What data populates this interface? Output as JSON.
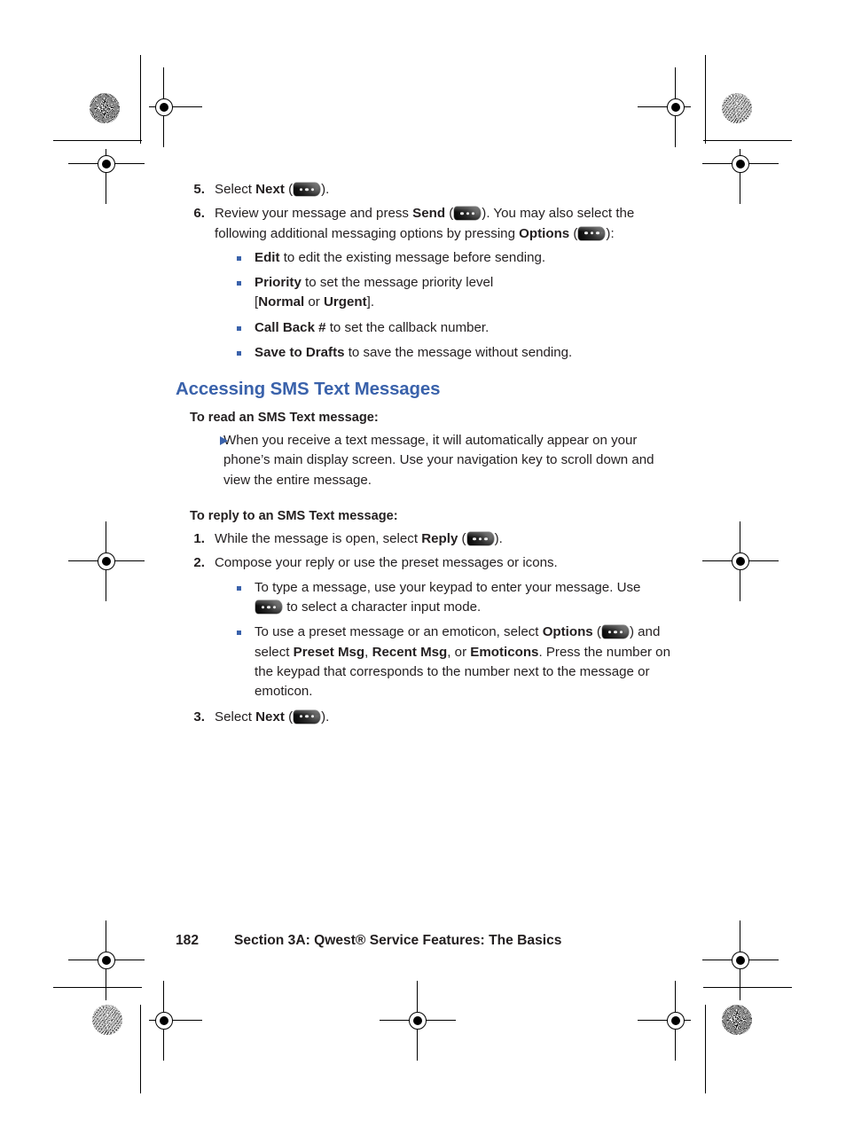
{
  "theme": {
    "accent_blue": "#3a62ab",
    "text_color": "#231f20",
    "bullet_color": "#3a62ab"
  },
  "icons": {
    "softkey": "softkey-three-dots-icon",
    "registration": "registration-crosshair-icon",
    "rosette": "print-rosette-icon",
    "square_bullet": "square-bullet-icon",
    "arrow_bullet": "triangle-bullet-icon"
  },
  "steps_top": [
    {
      "num": "5.",
      "segments": [
        {
          "t": "Select "
        },
        {
          "t": "Next",
          "b": true
        },
        {
          "t": " ("
        },
        {
          "t": "",
          "icon": "softkey"
        },
        {
          "t": ")."
        }
      ]
    },
    {
      "num": "6.",
      "segments": [
        {
          "t": "Review your message and press "
        },
        {
          "t": "Send",
          "b": true
        },
        {
          "t": " ("
        },
        {
          "t": "",
          "icon": "softkey"
        },
        {
          "t": "). You may also select the following additional messaging options by pressing "
        },
        {
          "t": "Options",
          "b": true
        },
        {
          "t": " ("
        },
        {
          "t": "",
          "icon": "softkey"
        },
        {
          "t": "):"
        }
      ]
    }
  ],
  "option_bullets": [
    {
      "segments": [
        {
          "t": "Edit",
          "b": true
        },
        {
          "t": " to edit the existing message before sending."
        }
      ]
    },
    {
      "segments": [
        {
          "t": "Priority",
          "b": true
        },
        {
          "t": " to set the message priority level"
        },
        {
          "br": true
        },
        {
          "t": "["
        },
        {
          "t": "Normal",
          "b": true
        },
        {
          "t": " or "
        },
        {
          "t": "Urgent",
          "b": true
        },
        {
          "t": "]."
        }
      ]
    },
    {
      "segments": [
        {
          "t": "Call Back #",
          "b": true
        },
        {
          "t": " to set the callback number."
        }
      ]
    },
    {
      "segments": [
        {
          "t": "Save to Drafts",
          "b": true
        },
        {
          "t": " to save the message without sending."
        }
      ]
    }
  ],
  "section": {
    "heading": "Accessing SMS Text Messages",
    "read_lead_in": "To read an SMS Text message:",
    "read_arrow_item": "When you receive a text message, it will automatically appear on your phone’s main display screen. Use your navigation key to scroll down and view the entire message.",
    "reply_lead_in": "To reply to an SMS Text message:"
  },
  "steps_reply": [
    {
      "num": "1.",
      "segments": [
        {
          "t": "While the message is open, select "
        },
        {
          "t": "Reply",
          "b": true
        },
        {
          "t": " ("
        },
        {
          "t": "",
          "icon": "softkey"
        },
        {
          "t": ")."
        }
      ]
    },
    {
      "num": "2.",
      "segments": [
        {
          "t": "Compose your reply or use the preset messages or icons."
        }
      ]
    },
    {
      "num": "3.",
      "segments": [
        {
          "t": "Select "
        },
        {
          "t": "Next",
          "b": true
        },
        {
          "t": " ("
        },
        {
          "t": "",
          "icon": "softkey"
        },
        {
          "t": ")."
        }
      ]
    }
  ],
  "reply_bullets": [
    {
      "segments": [
        {
          "t": "To type a message, use your keypad to enter your message. Use "
        },
        {
          "t": "",
          "icon": "softkey"
        },
        {
          "t": " to select a character input mode."
        }
      ]
    },
    {
      "segments": [
        {
          "t": "To use a preset message or an emoticon, select "
        },
        {
          "t": "Options",
          "b": true
        },
        {
          "t": " ("
        },
        {
          "t": "",
          "icon": "softkey"
        },
        {
          "t": ") and select "
        },
        {
          "t": "Preset Msg",
          "b": true
        },
        {
          "t": ", "
        },
        {
          "t": "Recent Msg",
          "b": true
        },
        {
          "t": ", or "
        },
        {
          "t": "Emoticons",
          "b": true
        },
        {
          "t": ". Press the number on the keypad that corresponds to the number next to the message or emoticon."
        }
      ]
    }
  ],
  "footer": {
    "page_number": "182",
    "section_text": "Section 3A: Qwest® Service Features: The Basics"
  }
}
